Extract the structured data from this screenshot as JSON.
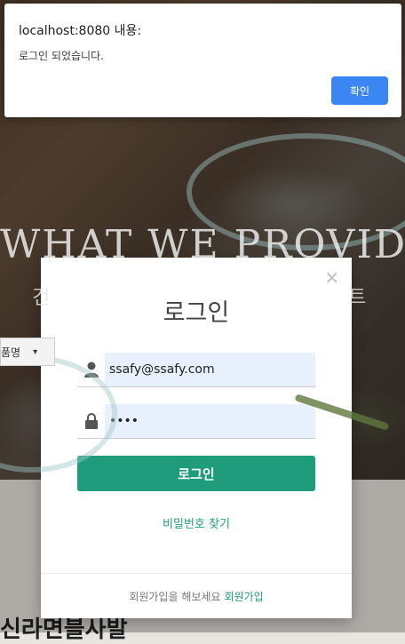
{
  "background": {
    "url_fragment": "I",
    "hero_title": "WHAT WE PROVIDE",
    "hero_subtitle_left": "건",
    "hero_subtitle_right": "트",
    "select_label": "품명",
    "section_heading": "신라면블사발"
  },
  "alert": {
    "title": "localhost:8080 내용:",
    "message": "로그인 되었습니다.",
    "ok_label": "확인",
    "ok_color": "#3b86f5"
  },
  "login_modal": {
    "close_glyph": "×",
    "title": "로그인",
    "email_value": "ssafy@ssafy.com",
    "password_value": "••••",
    "submit_label": "로그인",
    "forgot_password": "비밀번호 찾기",
    "footer_text": "회원가입을 해보세요",
    "signup_link": "회원가입",
    "accent_color": "#1e9c7c",
    "icons": {
      "email": "user-icon",
      "password": "lock-icon"
    }
  }
}
